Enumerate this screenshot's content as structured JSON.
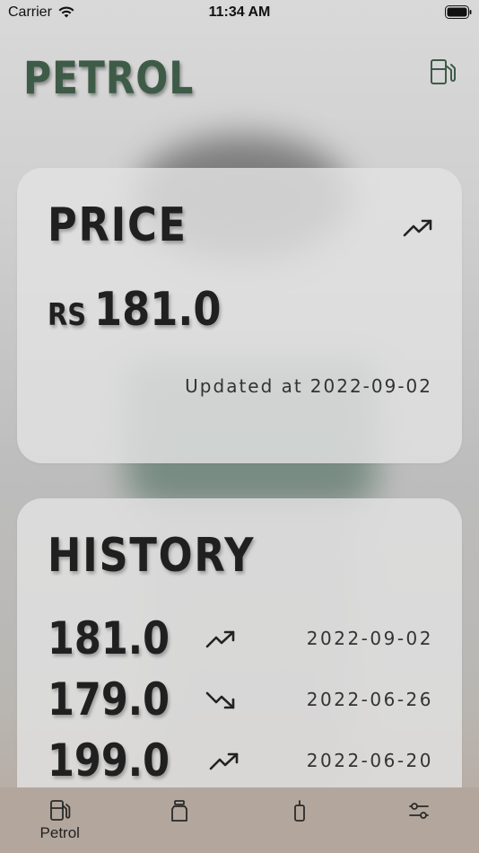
{
  "status_bar": {
    "carrier": "Carrier",
    "time": "11:34 AM"
  },
  "header": {
    "title": "PETROL",
    "icon": "fuel-pump-icon"
  },
  "price_card": {
    "heading": "PRICE",
    "trend_icon": "trend-up-icon",
    "currency": "RS",
    "value": "181.0",
    "updated_label": "Updated at",
    "updated_date": "2022-09-02"
  },
  "history_card": {
    "heading": "HISTORY",
    "rows": [
      {
        "price": "181.0",
        "trend": "trend-up-icon",
        "date": "2022-09-02"
      },
      {
        "price": "179.0",
        "trend": "trend-down-icon",
        "date": "2022-06-26"
      },
      {
        "price": "199.0",
        "trend": "trend-up-icon",
        "date": "2022-06-20"
      }
    ]
  },
  "tab_bar": {
    "tabs": [
      {
        "label": "Petrol",
        "icon": "fuel-pump-icon",
        "selected": true
      },
      {
        "label": "",
        "icon": "diesel-jerrycan-icon",
        "selected": false
      },
      {
        "label": "",
        "icon": "kerosene-bottle-icon",
        "selected": false
      },
      {
        "label": "",
        "icon": "settings-sliders-icon",
        "selected": false
      }
    ]
  },
  "colors": {
    "title_green": "#3e5b47",
    "tab_bar_bg": "#b3a79d",
    "card_bg": "#e2e2e2"
  }
}
